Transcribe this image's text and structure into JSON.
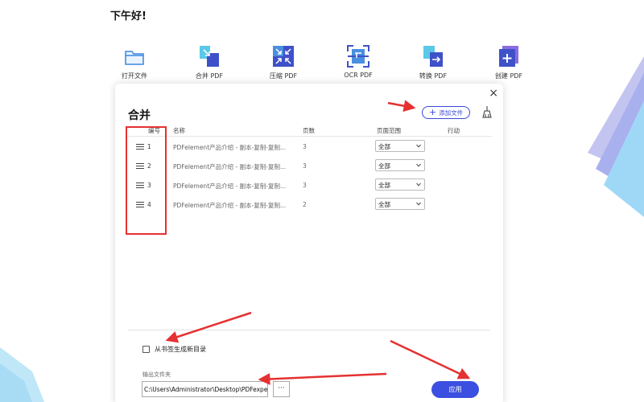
{
  "greeting": "下午好!",
  "toolbar": [
    {
      "label": "打开文件",
      "icon": "folder-icon"
    },
    {
      "label": "合并 PDF",
      "icon": "merge-icon"
    },
    {
      "label": "压缩 PDF",
      "icon": "compress-icon"
    },
    {
      "label": "OCR PDF",
      "icon": "ocr-icon"
    },
    {
      "label": "转换 PDF",
      "icon": "convert-icon"
    },
    {
      "label": "创建 PDF",
      "icon": "create-icon"
    }
  ],
  "dialog": {
    "title": "合并",
    "close_glyph": "×",
    "add_file_label": "添加文件",
    "add_file_plus": "+",
    "headers": {
      "num": "编号",
      "name": "名称",
      "pages": "页数",
      "range": "页面范围",
      "action": "行动"
    },
    "rows": [
      {
        "num": "1",
        "name": "PDFelement产品介绍 - 副本-复制-复制...",
        "pages": "3",
        "range": "全部"
      },
      {
        "num": "2",
        "name": "PDFelement产品介绍 - 副本-复制-复制...",
        "pages": "3",
        "range": "全部"
      },
      {
        "num": "3",
        "name": "PDFelement产品介绍 - 副本-复制-复制...",
        "pages": "3",
        "range": "全部"
      },
      {
        "num": "4",
        "name": "PDFelement产品介绍 - 副本-复制-复制...",
        "pages": "2",
        "range": "全部"
      }
    ],
    "bookmark_label": "从书签生成新目录",
    "bookmark_checked": false,
    "output_label": "输出文件夹",
    "output_path": "C:\\Users\\Administrator\\Desktop\\PDFexpert",
    "browse_label": "···",
    "apply_label": "应用"
  },
  "colors": {
    "accent": "#3b50e0",
    "annotation_red": "#e53131"
  }
}
